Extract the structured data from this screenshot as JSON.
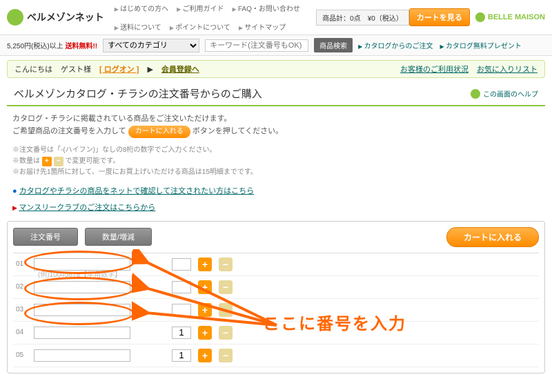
{
  "header": {
    "logo_text": "ベルメゾンネット",
    "links": [
      "はじめての方へ",
      "ご利用ガイド",
      "FAQ・お問い合わせ",
      "送料について",
      "ポイントについて",
      "サイトマップ"
    ],
    "cart_summary": "商品計：0点　¥0（税込）",
    "cart_btn": "カートを見る",
    "brand": "BELLE MAISON"
  },
  "subbar": {
    "shipping_prefix": "5,250円(税込)以上",
    "shipping_free": "送料無料!!",
    "category": "すべてのカテゴリ",
    "search_placeholder": "キーワード(注文番号もOK)",
    "search_btn": "商品検索",
    "cat_links": [
      "カタログからのご注文",
      "カタログ無料プレゼント"
    ]
  },
  "greet": {
    "hello": "こんにちは",
    "guest": "ゲスト様",
    "login": "[ ログオン ]",
    "register": "会員登録へ",
    "usage": "お客様のご利用状況",
    "fav": "お気に入りリスト"
  },
  "page": {
    "title": "ベルメゾンカタログ・チラシの注文番号からのご購入",
    "help": "この画面のヘルプ"
  },
  "intro": {
    "line1": "カタログ・チラシに掲載されている商品をご注文いただけます。",
    "line2a": "ご希望商品の注文番号を入力して",
    "cart_pill": "カートに入れる",
    "line2b": "ボタンを押してください。"
  },
  "notes": {
    "n1": "※注文番号は「-(ハイフン)」なしの8桁の数字でご入力ください。",
    "n2a": "※数量は",
    "n2b": "で変更可能です。",
    "n3": "※お届け先1箇所に対して、一度にお買上げいただける商品は15明細までです。"
  },
  "links": {
    "l1": "カタログやチラシの商品をネットで確認して注文されたい方はこちら",
    "l2": "マンスリークラブのご注文はこちらから"
  },
  "order": {
    "col1": "注文番号",
    "col2": "数量/増減",
    "cart_btn": "カートに入れる",
    "example": "(例)10045678【半角数字】",
    "rows": [
      {
        "num": "01",
        "qty": ""
      },
      {
        "num": "02",
        "qty": ""
      },
      {
        "num": "03",
        "qty": ""
      },
      {
        "num": "04",
        "qty": "1"
      },
      {
        "num": "05",
        "qty": "1"
      }
    ]
  },
  "annotation": {
    "text": "ここに番号を入力"
  }
}
